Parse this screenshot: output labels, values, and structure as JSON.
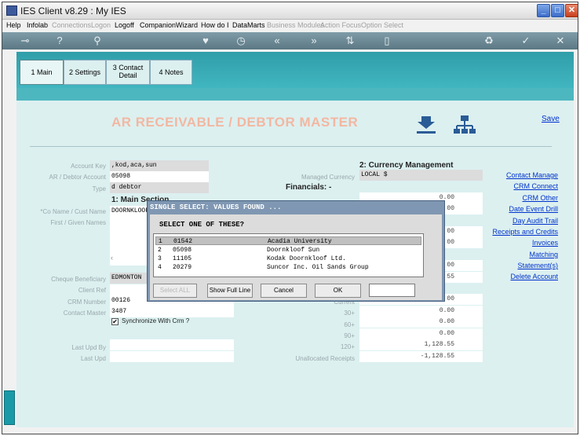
{
  "window": {
    "title": "IES Client v8.29 : My IES"
  },
  "menu": [
    {
      "label": "Help",
      "enabled": true
    },
    {
      "label": "Infolab",
      "enabled": true
    },
    {
      "label": "Connections",
      "enabled": false
    },
    {
      "label": "Logon",
      "enabled": false
    },
    {
      "label": "Logoff",
      "enabled": true
    },
    {
      "label": "Companion",
      "enabled": true
    },
    {
      "label": "Wizard",
      "enabled": true
    },
    {
      "label": "How do I",
      "enabled": true
    },
    {
      "label": "DataMarts",
      "enabled": true
    },
    {
      "label": "Business Modules",
      "enabled": false
    },
    {
      "label": "Action Focus",
      "enabled": false
    },
    {
      "label": "Option Select",
      "enabled": false
    }
  ],
  "tabs": [
    {
      "label": "1 Main"
    },
    {
      "label": "2 Settings"
    },
    {
      "label": "3 Contact Detail"
    },
    {
      "label": "4 Notes"
    }
  ],
  "page": {
    "title": "AR RECEIVABLE / DEBTOR MASTER",
    "save": "Save"
  },
  "form": {
    "account_key_label": "Account Key",
    "account_key": ",kod,aca,sun",
    "debtor_account_label": "AR / Debtor Account",
    "debtor_account": "05098",
    "type_label": "Type",
    "type": "d debtor",
    "main_section": "1: Main Section",
    "co_name_label": "*Co Name / Cust Name",
    "co_name": "DOORNKLOOF SUN",
    "first_name_label": "First / Given Names",
    "cheque_label": "Cheque Beneficiary",
    "cheque": "EDMONTON",
    "client_ref_label": "Client Ref",
    "crm_number_label": "CRM Number",
    "crm_number": "00126",
    "contact_master_label": "Contact Master",
    "contact_master": "3487",
    "sync_label": "Synchronize With Crm ?",
    "last_upd_by_label": "Last Upd By",
    "last_upd_label": "Last Upd"
  },
  "currency": {
    "heading": "2: Currency Management",
    "managed_label": "Managed Currency",
    "managed": "LOCAL $",
    "financials": "Financials: -",
    "values": [
      "0.00",
      "00",
      "00",
      "00",
      "00",
      "55",
      "00",
      "0.00",
      "0.00",
      "0.00",
      "1,128.55",
      "-1,128.55"
    ],
    "current_label": "Current",
    "aging_labels": [
      "30+",
      "60+",
      "90+",
      "120+"
    ],
    "unallocated_label": "Unallocated Receipts"
  },
  "links": [
    "Contact Manage",
    "CRM Connect",
    "CRM Other",
    "Date Event Drill",
    "Day Audit Trail",
    "Receipts and Credits",
    "Invoices",
    "Matching",
    "Statement(s)",
    "Delete Account"
  ],
  "dialog": {
    "title": "SINGLE SELECT: VALUES FOUND ...",
    "prompt": "SELECT ONE OF THESE?",
    "rows": [
      {
        "n": "1",
        "code": "01542",
        "name": "Acadia University"
      },
      {
        "n": "2",
        "code": "05098",
        "name": "Doornkloof Sun"
      },
      {
        "n": "3",
        "code": "11105",
        "name": "Kodak Doornkloof Ltd."
      },
      {
        "n": "4",
        "code": "20279",
        "name": "Suncor Inc. Oil Sands Group"
      }
    ],
    "buttons": {
      "select_all": "Select ALL",
      "show_full_line": "Show Full Line",
      "cancel": "Cancel",
      "ok": "OK"
    }
  },
  "colors": {
    "toolbar": "#6b8a96",
    "tabstrip": "#2f9ea9",
    "title_accent": "#f3b7a1",
    "link": "#0033cc"
  }
}
